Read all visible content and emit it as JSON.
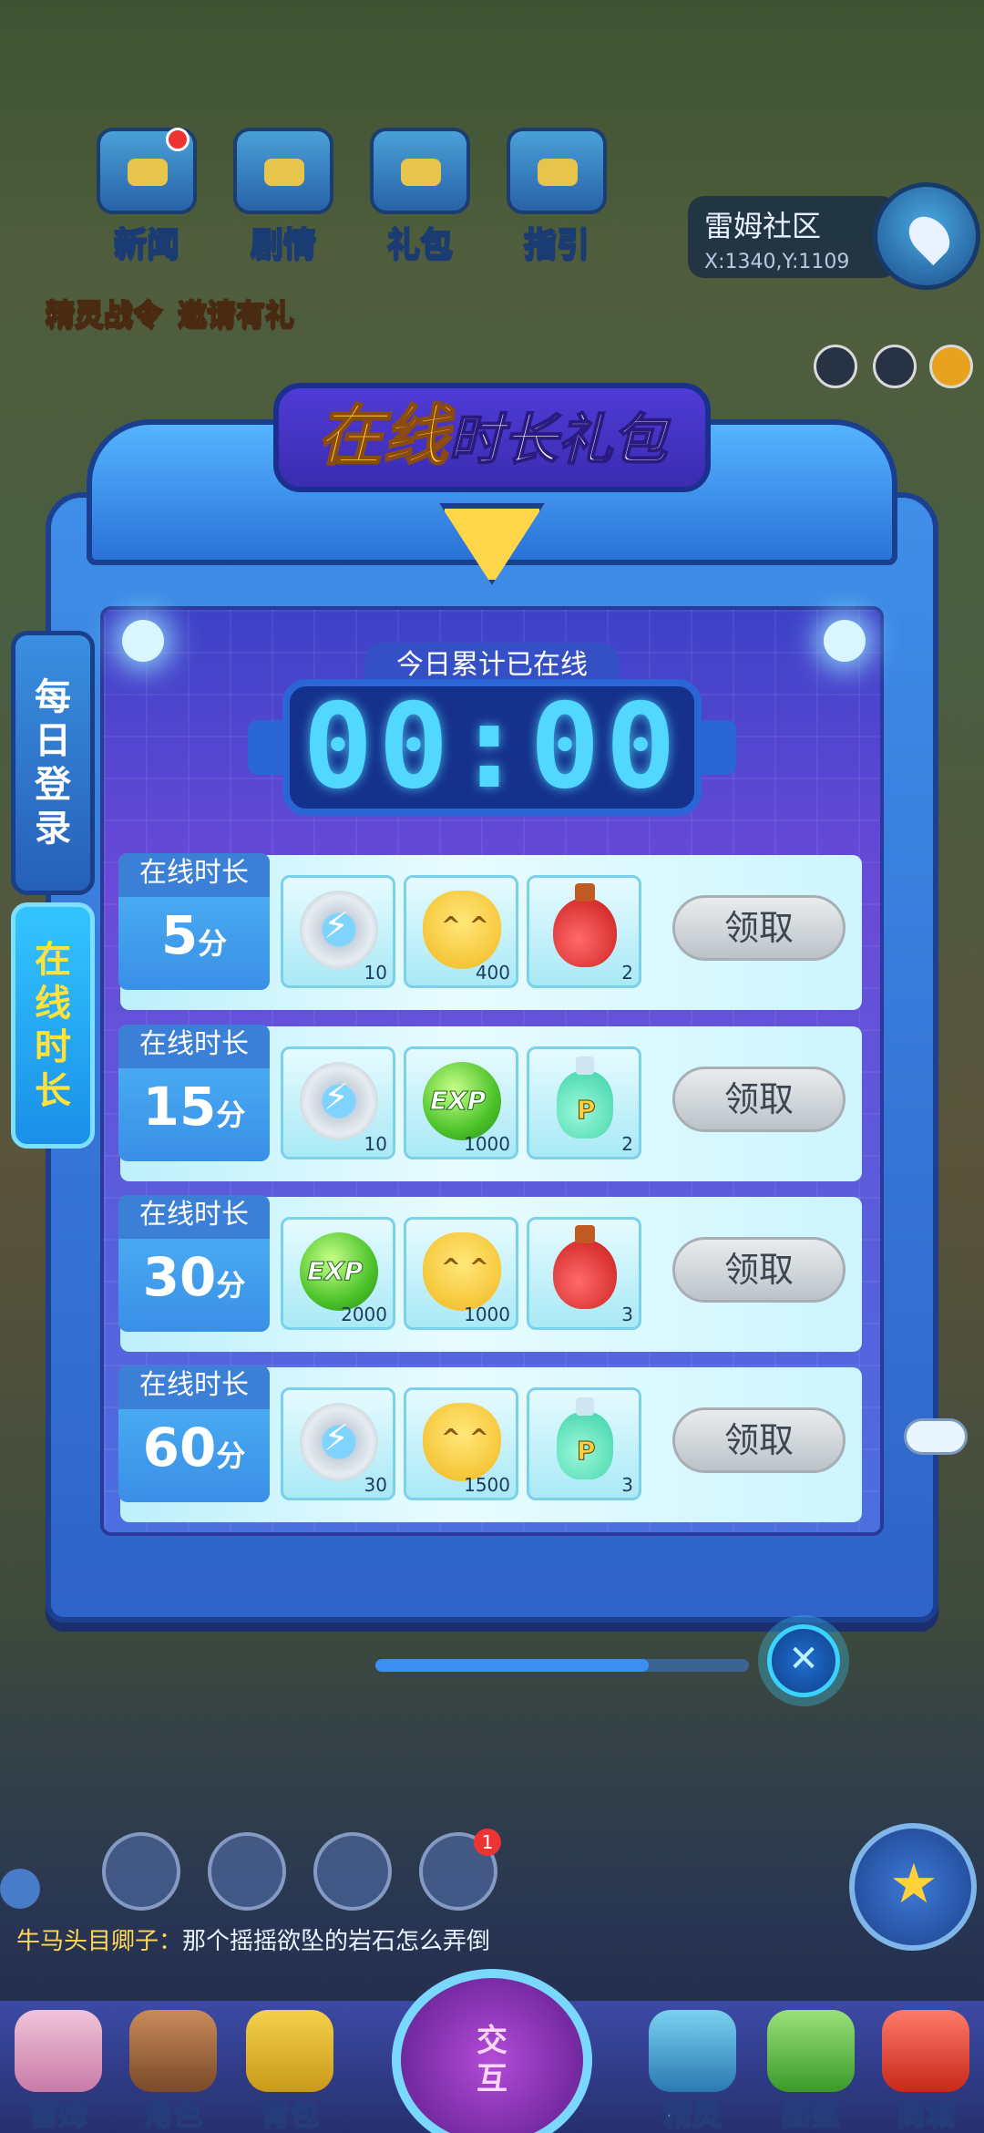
{
  "top_menu": [
    {
      "label": "新闻",
      "icon": "news-icon",
      "badge": true
    },
    {
      "label": "剧情",
      "icon": "story-icon",
      "badge": false
    },
    {
      "label": "礼包",
      "icon": "gift-icon",
      "badge": false
    },
    {
      "label": "指引",
      "icon": "guide-icon",
      "badge": false
    }
  ],
  "location": {
    "name": "雷姆社区",
    "coords": "X:1340,Y:1109"
  },
  "second_row": [
    "精灵战令",
    "邀请有礼"
  ],
  "panel": {
    "title_highlight": "在线",
    "title_rest": "时长礼包",
    "timer_label": "今日累计已在线",
    "timer_value": "00:00"
  },
  "side_tabs": [
    {
      "label": "每日登录",
      "active": false
    },
    {
      "label": "在线时长",
      "active": true
    }
  ],
  "reward_rows": [
    {
      "caption": "在线时长",
      "minutes": "5",
      "unit": "分",
      "items": [
        {
          "icon": "lightning-badge-icon",
          "count": "10"
        },
        {
          "icon": "cat-coin-icon",
          "count": "400"
        },
        {
          "icon": "red-potion-icon",
          "count": "2"
        }
      ],
      "button": "领取"
    },
    {
      "caption": "在线时长",
      "minutes": "15",
      "unit": "分",
      "items": [
        {
          "icon": "lightning-badge-icon",
          "count": "10"
        },
        {
          "icon": "exp-orb-icon",
          "count": "1000"
        },
        {
          "icon": "p-potion-icon",
          "count": "2"
        }
      ],
      "button": "领取"
    },
    {
      "caption": "在线时长",
      "minutes": "30",
      "unit": "分",
      "items": [
        {
          "icon": "exp-orb-icon",
          "count": "2000"
        },
        {
          "icon": "cat-coin-icon",
          "count": "1000"
        },
        {
          "icon": "red-potion-icon",
          "count": "3"
        }
      ],
      "button": "领取"
    },
    {
      "caption": "在线时长",
      "minutes": "60",
      "unit": "分",
      "items": [
        {
          "icon": "lightning-badge-icon",
          "count": "30"
        },
        {
          "icon": "cat-coin-icon",
          "count": "1500"
        },
        {
          "icon": "p-potion-icon",
          "count": "3"
        }
      ],
      "button": "领取"
    }
  ],
  "chat": {
    "speaker": "牛马头目卿子：",
    "message": "那个摇摇欲坠的岩石怎么弄倒"
  },
  "bottom_nav": [
    "雷姆",
    "角色",
    "背包",
    "精灵",
    "图鉴",
    "商城"
  ],
  "center_button": "交互",
  "notification_count": "1"
}
